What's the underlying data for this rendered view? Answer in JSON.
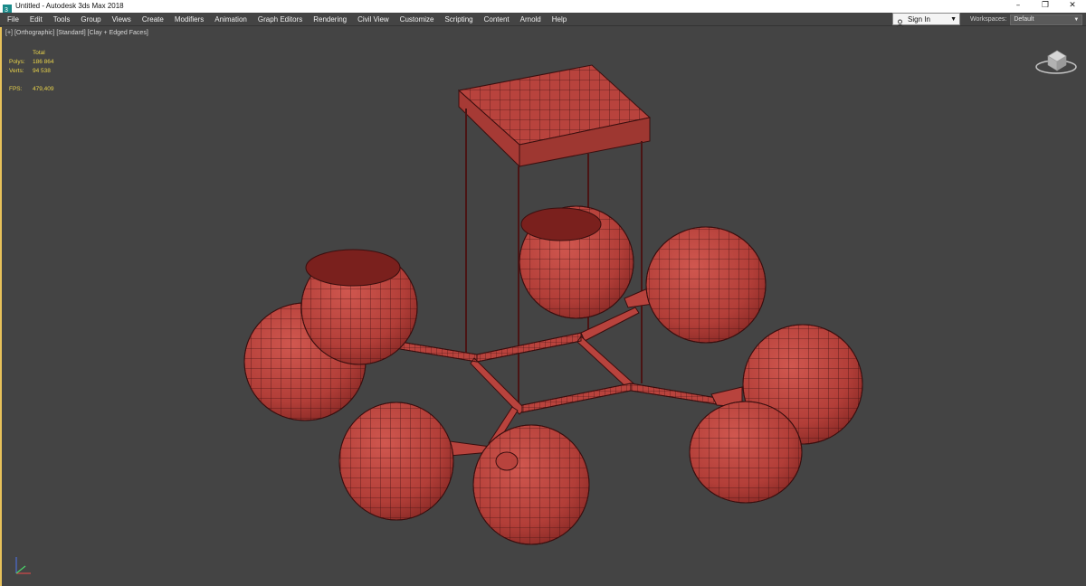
{
  "window": {
    "title": "Untitled - Autodesk 3ds Max 2018",
    "buttons": {
      "minimize": "–",
      "restore": "❐",
      "close": "✕"
    }
  },
  "menu": {
    "items": [
      "File",
      "Edit",
      "Tools",
      "Group",
      "Views",
      "Create",
      "Modifiers",
      "Animation",
      "Graph Editors",
      "Rendering",
      "Civil View",
      "Customize",
      "Scripting",
      "Content",
      "Arnold",
      "Help"
    ]
  },
  "signin": {
    "label": "Sign In"
  },
  "workspaces": {
    "label": "Workspaces:",
    "value": "Default"
  },
  "viewport": {
    "label_parts": [
      "[+]",
      "[Orthographic]",
      "[Standard]",
      "[Clay + Edged Faces]"
    ],
    "stats": {
      "header": "Total",
      "polys_label": "Polys:",
      "polys_value": "186 864",
      "verts_label": "Verts:",
      "verts_value": "94 538",
      "fps_label": "FPS:",
      "fps_value": "479,409"
    }
  },
  "colors": {
    "viewport_bg": "#444444",
    "clay": "#b8433d",
    "wire": "#3a0f0f",
    "stats_text": "#e8d24a",
    "active_border": "#e8c25a"
  }
}
